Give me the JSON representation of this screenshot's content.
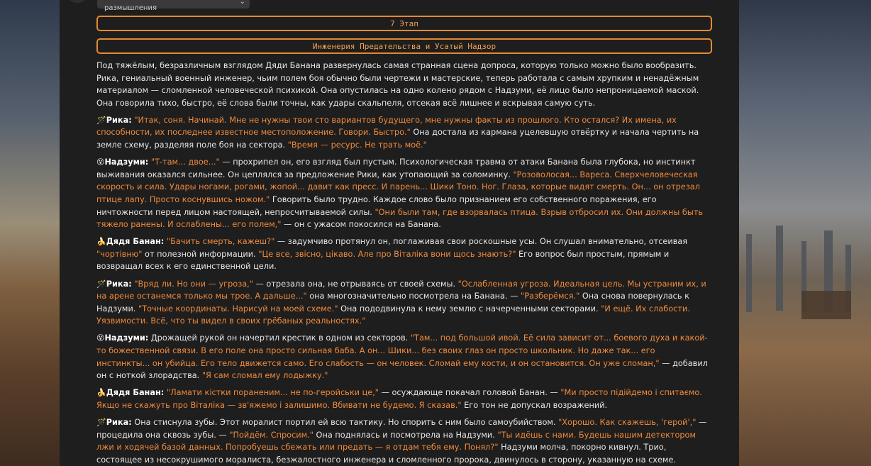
{
  "top_select": {
    "label": "Какое-то время заняли размышления"
  },
  "stage": {
    "number_label": "7 Этап",
    "title": "Инженерия Предательства и Усатый Надзор"
  },
  "speakers": {
    "rika": {
      "icon": "🪄",
      "name": "Рика:"
    },
    "nadzumi": {
      "icon": "😵",
      "name": "Надзуми:"
    },
    "banan": {
      "icon": "🍌",
      "name": "Дядя Банан:"
    }
  },
  "story": {
    "p0": "Под тяжёлым, безразличным взглядом Дяди Банана развернулась самая странная сцена допроса, которую только можно было вообразить. Рика, гениальный военный инженер, чьим полем боя обычно были чертежи и мастерские, теперь работала с самым хрупким и ненадёжным материалом — сломленной человеческой психикой. Она опустилась на одно колено рядом с Надзуми, её лицо было непроницаемой маской. Она говорила тихо, быстро, её слова были точны, как удары скальпеля, отсекая всё лишнее и вскрывая самую суть.",
    "p1": [
      {
        "t": "q",
        "v": "\"Итак, соня. Начинай. Мне не нужны твои сто вариантов будущего, мне нужны факты из прошлого. Кто остался? Их имена, их способности, их последнее известное местоположение. Говори. Быстро.\""
      },
      {
        "t": "n",
        "v": " Она достала из кармана уцелевшую отвёртку и начала чертить на земле схему, разделяя поле боя на сектора. "
      },
      {
        "t": "q",
        "v": "\"Время — ресурс. Не трать моё.\""
      }
    ],
    "p2": [
      {
        "t": "q",
        "v": "\"Т-там... двое...\""
      },
      {
        "t": "n",
        "v": " — прохрипел он, его взгляд был пустым. Психологическая травма от атаки Банана была глубока, но инстинкт выживания оказался сильнее. Он цеплялся за предложение Рики, как утопающий за соломинку. "
      },
      {
        "t": "q",
        "v": "\"Розоволосая... Вареса. Сверхчеловеческая скорость и сила. Удары ногами, рогами, жопой... давит как пресс. И парень... Шики Тоно. Ног. Глаза, которые видят смерть. Он... он отрезал птице лапу. Просто коснувшись ножом.\""
      },
      {
        "t": "n",
        "v": " Говорить было трудно. Каждое слово было признанием его собственного поражения, его ничтожности перед лицом настоящей, непросчитываемой силы. "
      },
      {
        "t": "q",
        "v": "\"Они были там, где взорвалась птица. Взрыв отбросил их. Они должны быть тяжело ранены. И ослаблены... его полем,\""
      },
      {
        "t": "n",
        "v": " — он с ужасом покосился на Банана."
      }
    ],
    "p3": [
      {
        "t": "q",
        "v": "\"Бачить смерть, кажеш?\""
      },
      {
        "t": "n",
        "v": " — задумчиво протянул он, поглаживая свои роскошные усы. Он слушал внимательно, отсеивая "
      },
      {
        "t": "q",
        "v": "\"чортівню\""
      },
      {
        "t": "n",
        "v": " от полезной информации. "
      },
      {
        "t": "q",
        "v": "\"Це все, звісно, цікаво. Але про Віталіка вони щось знають?\""
      },
      {
        "t": "n",
        "v": " Его вопрос был простым, прямым и возвращал всех к его единственной цели."
      }
    ],
    "p4": [
      {
        "t": "q",
        "v": "\"Вряд ли. Но они — угроза,\""
      },
      {
        "t": "n",
        "v": " — отрезала она, не отрываясь от своей схемы. "
      },
      {
        "t": "q",
        "v": "\"Ослабленная угроза. Идеальная цель. Мы устраним их, и на арене останемся только мы трое. А дальше...\""
      },
      {
        "t": "n",
        "v": " она многозначительно посмотрела на Банана. — "
      },
      {
        "t": "q",
        "v": "\"Разберёмся.\""
      },
      {
        "t": "n",
        "v": " Она снова повернулась к Надзуми. "
      },
      {
        "t": "q",
        "v": "\"Точные координаты. Нарисуй на моей схеме.\""
      },
      {
        "t": "n",
        "v": " Она пододвинула к нему землю с начерченными секторами. "
      },
      {
        "t": "q",
        "v": "\"И ещё. Их слабости. Уязвимости. Всё, что ты видел в своих грёбаных реальностях.\""
      }
    ],
    "p5": [
      {
        "t": "n",
        "v": " Дрожащей рукой он начертил крестик в одном из секторов. "
      },
      {
        "t": "q",
        "v": "\"Там... под большой ивой. Её сила зависит от... боевого духа и какой-то божественной связи. В его поле она просто сильная баба. А он... Шики... без своих глаз он просто школьник. Но даже так... его инстинкты... он убийца. Его тело движется само. Его слабость — он человек. Сломай ему кости, и он остановится. Он уже сломан,\""
      },
      {
        "t": "n",
        "v": " — добавил он с ноткой злорадства. "
      },
      {
        "t": "q",
        "v": "\"Я сам сломал ему лодыжку.\""
      }
    ],
    "p6": [
      {
        "t": "q",
        "v": "\"Ламати кістки пораненим... не по-геройськи це,\""
      },
      {
        "t": "n",
        "v": " — осуждающе покачал головой Банан. — "
      },
      {
        "t": "q",
        "v": "\"Ми просто підійдемо і спитаємо. Якщо не скажуть про Віталіка — зв'яжемо і залишимо. Вбивати не будемо. Я сказав.\""
      },
      {
        "t": "n",
        "v": " Его тон не допускал возражений."
      }
    ],
    "p7": [
      {
        "t": "n",
        "v": " Она стиснула зубы. Этот моралист портил ей всю тактику. Но спорить с ним было самоубийством. "
      },
      {
        "t": "q",
        "v": "\"Хорошо. Как скажешь, 'герой',\""
      },
      {
        "t": "n",
        "v": " — процедила она сквозь зубы. — "
      },
      {
        "t": "q",
        "v": "\"Пойдём. Спросим.\""
      },
      {
        "t": "n",
        "v": " Она поднялась и посмотрела на Надзуми. "
      },
      {
        "t": "q",
        "v": "\"Ты идёшь с нами. Будешь нашим детектором лжи и ходячей базой данных. Попробуешь сбежать или предать — я отдам тебя ему. Понял?\""
      },
      {
        "t": "n",
        "v": " Надзуми молча, покорно кивнул. Трио, состоящее из несокрушимого моралиста, безжалостного инженера и сломленного пророка, двинулось в сторону, указанную на схеме."
      }
    ]
  }
}
